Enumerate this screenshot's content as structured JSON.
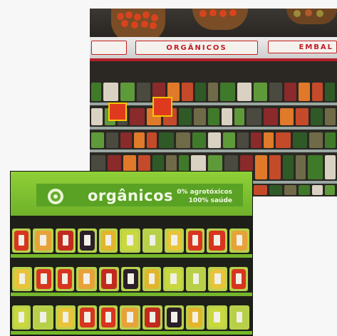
{
  "top_photo": {
    "sign_center": "ORGÂNICOS",
    "sign_right": "EMBAL",
    "colors": {
      "sign_text": "#c21c23",
      "shelf_edge": "#9aa7a3",
      "price_tag": "#e03a1e"
    }
  },
  "bottom_photo": {
    "title": "orgânicos",
    "claim_line1": "0% agrotóxicos",
    "claim_line2": "100% saúde",
    "colors": {
      "header": "#7cc030",
      "banner": "#5aa224",
      "shelf_edge": "#74b72c"
    }
  }
}
